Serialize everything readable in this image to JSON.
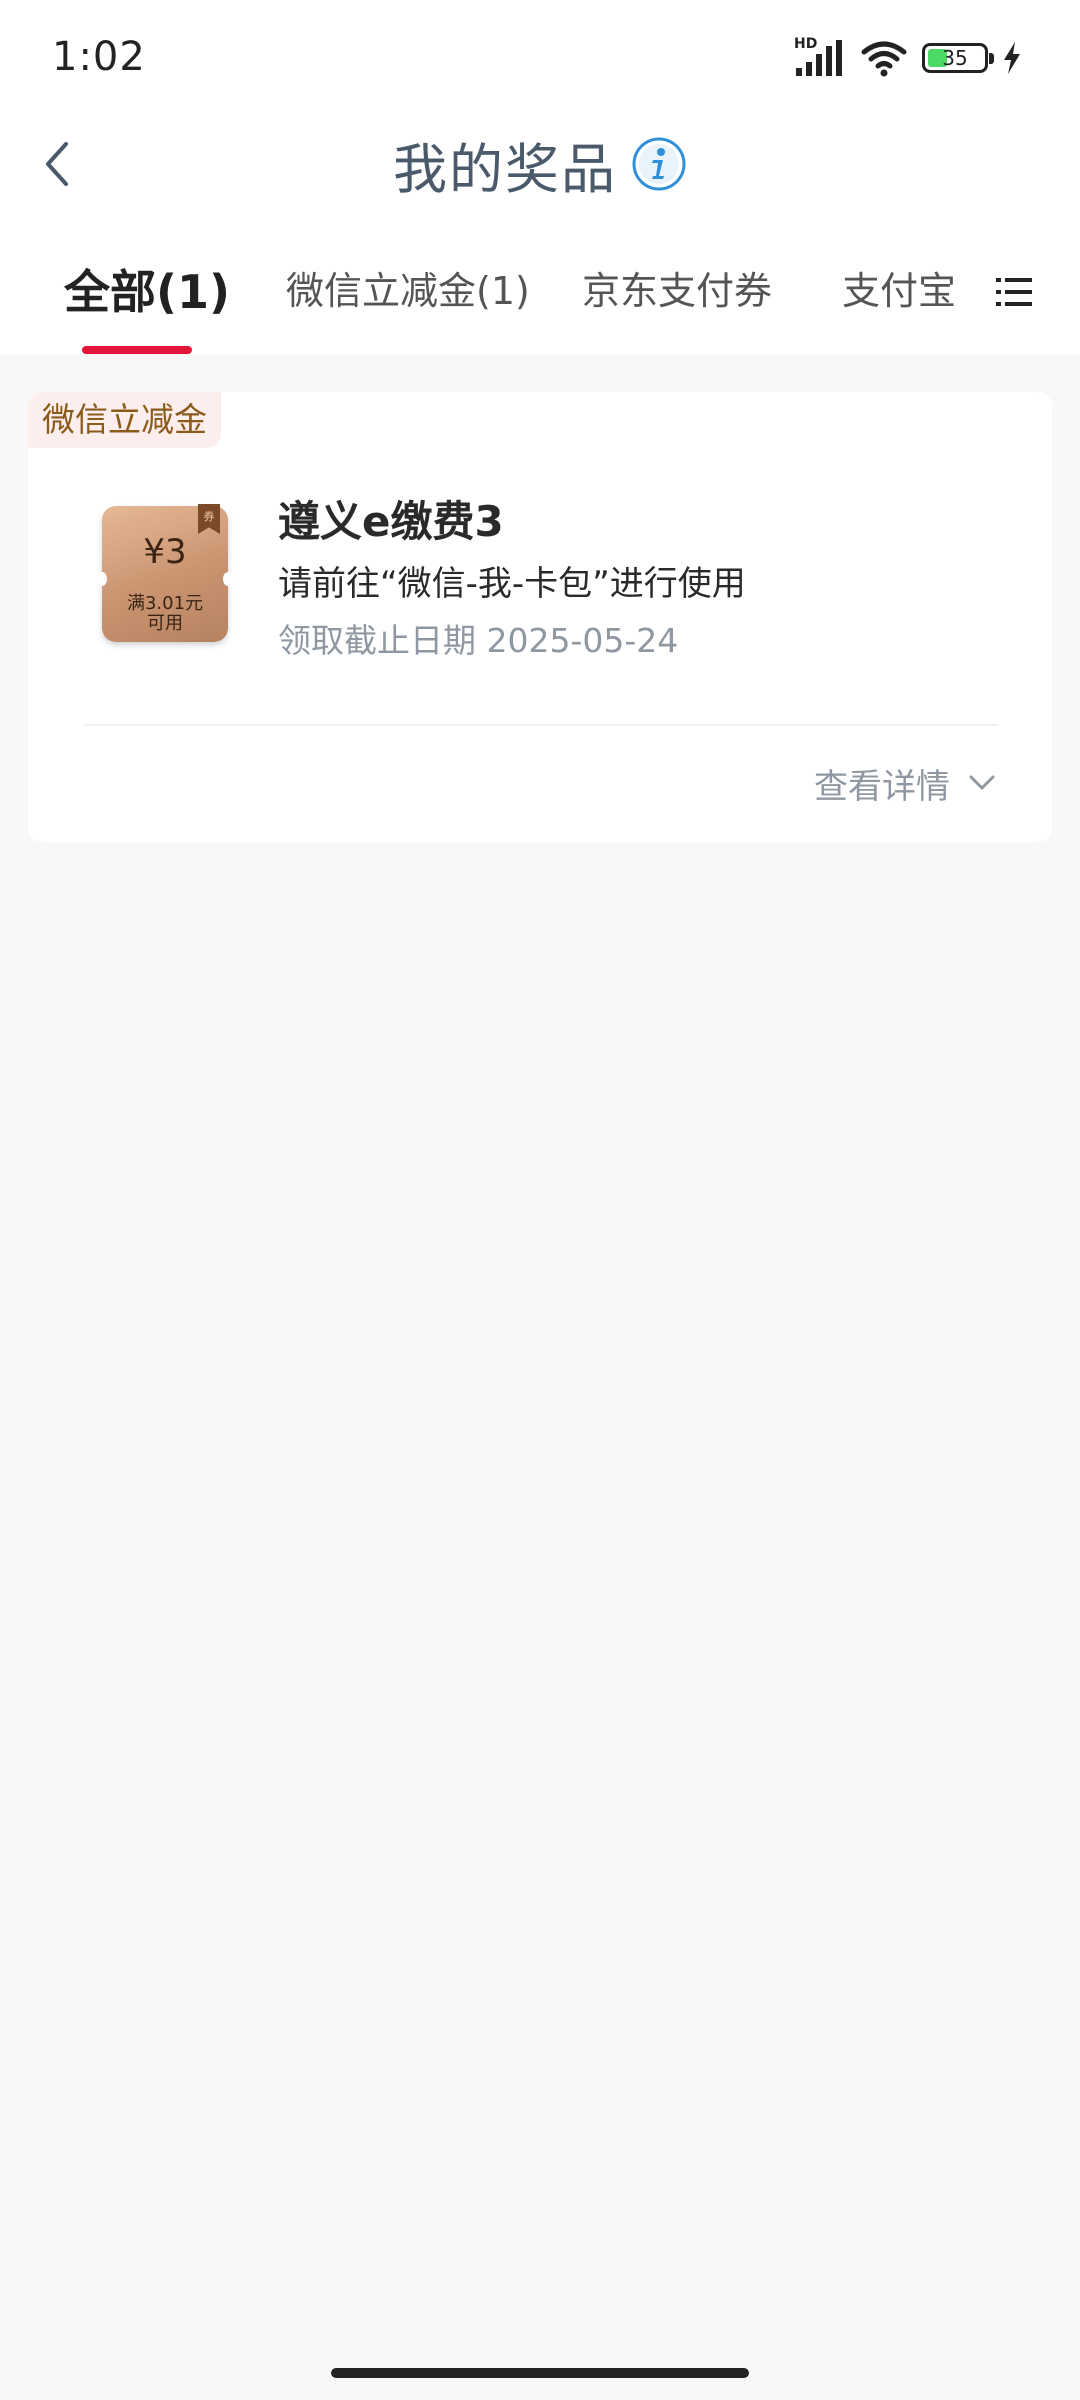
{
  "status_bar": {
    "time": "1:02",
    "network": "HD",
    "battery_level": "35",
    "battery_fraction": 0.35
  },
  "header": {
    "title": "我的奖品",
    "back_icon": "chevron-left-icon",
    "info_icon": "info-icon"
  },
  "tabs": [
    {
      "label": "全部(1)",
      "active": true
    },
    {
      "label": "微信立减金(1)",
      "active": false
    },
    {
      "label": "京东支付券",
      "active": false
    },
    {
      "label": "支付宝",
      "active": false
    }
  ],
  "tab_menu_icon": "list-icon",
  "prize": {
    "category": "微信立减金",
    "coupon_amount": "¥3",
    "coupon_condition_line1": "满3.01元",
    "coupon_condition_line2": "可用",
    "coupon_ribbon": "券",
    "title": "遵义e缴费3",
    "usage": "请前往“微信-我-卡包”进行使用",
    "deadline": "领取截止日期 2025-05-24",
    "details_label": "查看详情"
  },
  "colors": {
    "accent": "#e3163a",
    "title": "#4a5a6a",
    "tag_bg": "#fdeeee",
    "tag_text": "#8b5b1a",
    "muted": "#8f98a2",
    "info_blue": "#2f8fd8"
  }
}
